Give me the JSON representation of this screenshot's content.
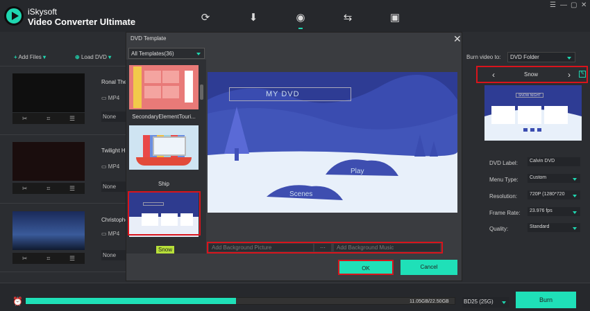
{
  "app": {
    "name": "iSkysoft",
    "product": "Video Converter Ultimate"
  },
  "nav": {
    "icons": [
      "convert-icon",
      "download-icon",
      "burn-icon",
      "transfer-icon",
      "toolbox-icon"
    ],
    "active": "burn-icon"
  },
  "window": {
    "controls": [
      "menu-icon",
      "minimize-icon",
      "maximize-icon",
      "close-icon"
    ]
  },
  "toolbar": {
    "add_files": "Add Files",
    "load_dvd": "Load DVD"
  },
  "videos": [
    {
      "name": "Ronal The",
      "format": "MP4",
      "subtitle": "None"
    },
    {
      "name": "Twilight H",
      "format": "MP4",
      "subtitle": "None"
    },
    {
      "name": "Christophe",
      "format": "MP4",
      "subtitle": "None"
    }
  ],
  "dialog": {
    "title": "DVD Template",
    "filter": "All Templates(36)",
    "templates": [
      {
        "name": "SecondaryElementTouri..."
      },
      {
        "name": "Ship"
      },
      {
        "name": "Snow"
      }
    ],
    "selected": "Snow",
    "preview": {
      "title": "MY DVD",
      "play": "Play",
      "scenes": "Scenes"
    },
    "bg_picture_placeholder": "Add Background Picture",
    "bg_music_placeholder": "Add Background Music",
    "browse": "···",
    "ok": "OK",
    "cancel": "Cancel"
  },
  "right": {
    "burn_label": "Burn video to:",
    "burn_target": "DVD Folder",
    "template_name": "Snow",
    "thumb_title": "SNOW NIGHT",
    "fields": [
      {
        "label": "DVD Label:",
        "value": "Calvin DVD"
      },
      {
        "label": "Menu Type:",
        "value": "Custom"
      },
      {
        "label": "Resolution:",
        "value": "720P (1280*720"
      },
      {
        "label": "Frame Rate:",
        "value": "23.976 fps"
      },
      {
        "label": "Quality:",
        "value": "Standard"
      }
    ]
  },
  "footer": {
    "size": "11.05GB/22.50GB",
    "disc": "BD25 (25G)",
    "burn": "Burn",
    "progress": 0.49
  },
  "colors": {
    "accent": "#1fe0b8",
    "highlight": "#d9141c",
    "bg": "#2b2d31"
  }
}
